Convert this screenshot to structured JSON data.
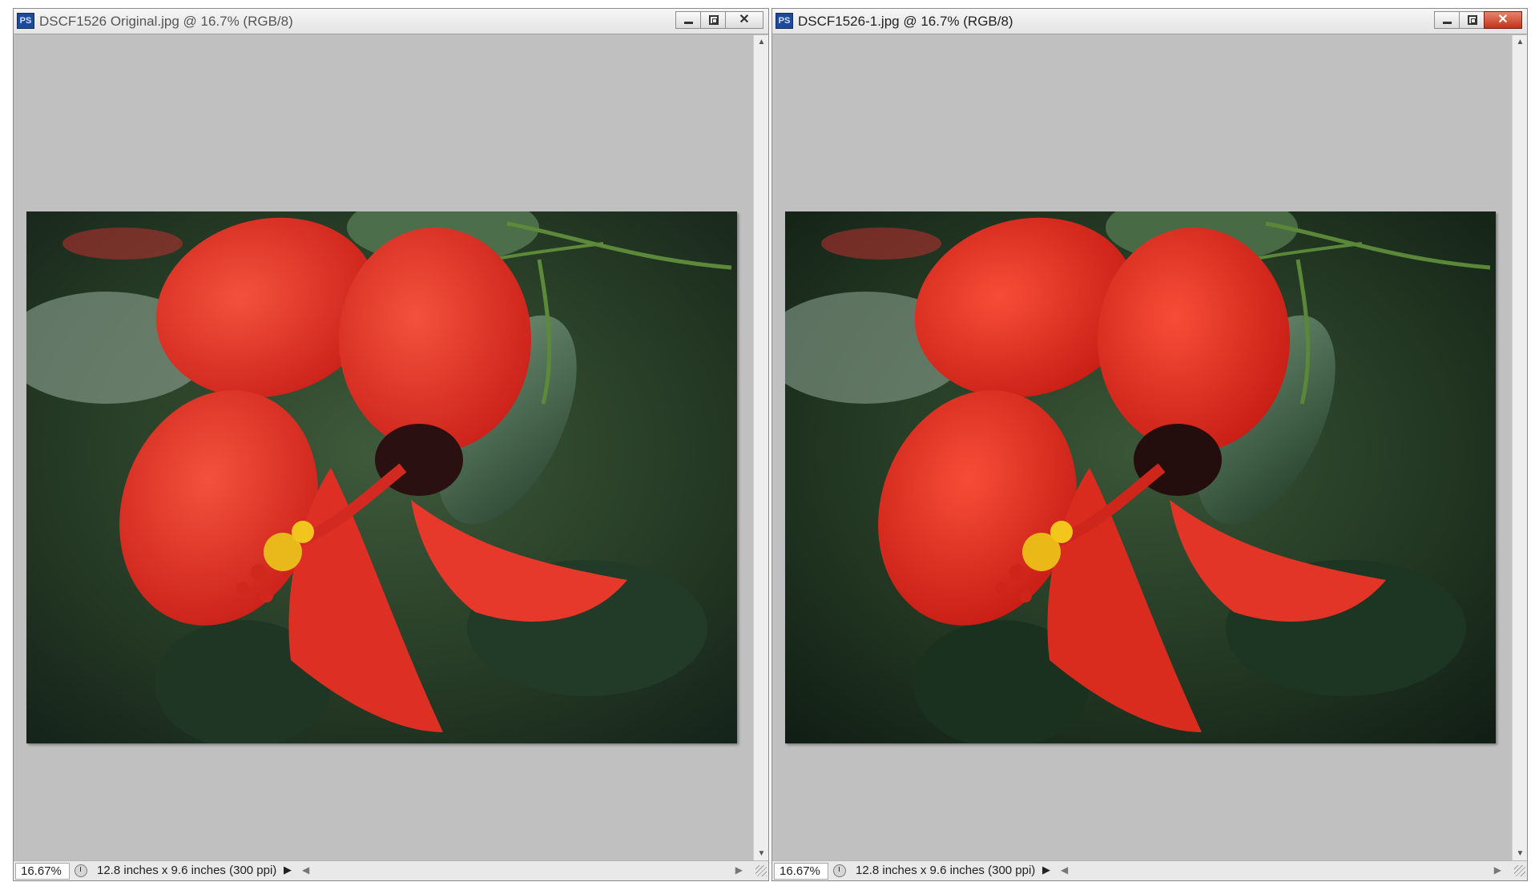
{
  "windows": [
    {
      "id": "left",
      "app_icon": "PS",
      "title": "DSCF1526 Original.jpg @ 16.7% (RGB/8)",
      "zoom": "16.67%",
      "doc_size": "12.8 inches x 9.6 inches (300 ppi)"
    },
    {
      "id": "right",
      "app_icon": "PS",
      "title": "DSCF1526-1.jpg @ 16.7% (RGB/8)",
      "zoom": "16.67%",
      "doc_size": "12.8 inches x 9.6 inches (300 ppi)"
    }
  ],
  "icons": {
    "minimize": "minimize-icon",
    "maximize": "maximize-icon",
    "close": "close-icon",
    "status": "status-info-icon",
    "menu": "triangle-right-icon",
    "scroll_left": "chevron-left-icon",
    "scroll_right": "chevron-right-icon",
    "scroll_up": "chevron-up-icon",
    "scroll_down": "chevron-down-icon"
  },
  "colors": {
    "close_active": "#c2331a",
    "canvas_bg": "#c0c0c0",
    "flower_red": "#e8372a"
  }
}
